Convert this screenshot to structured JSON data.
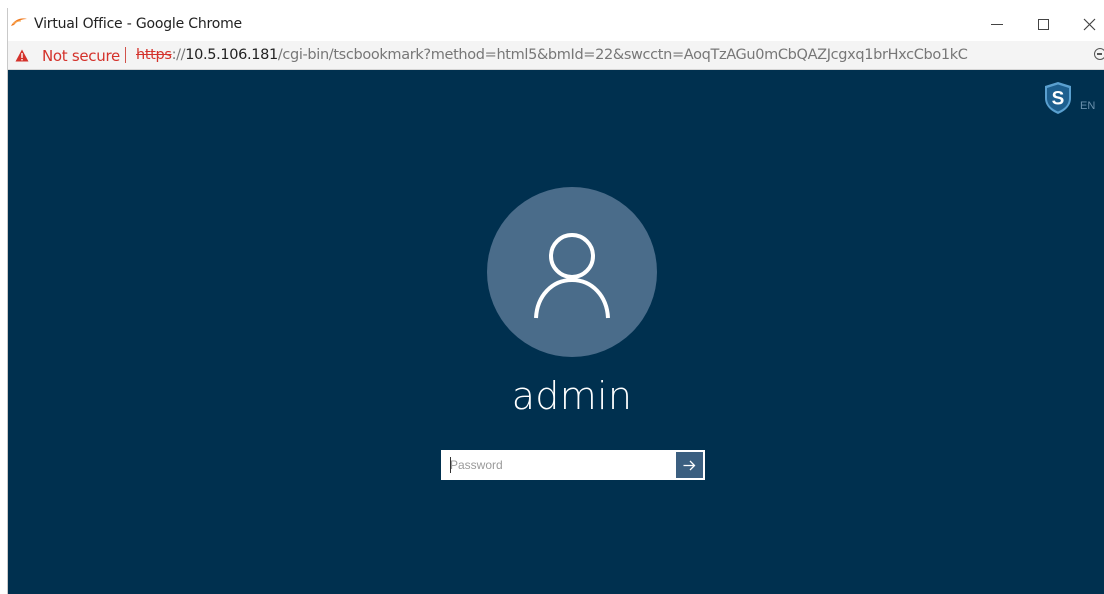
{
  "window": {
    "title": "Virtual Office - Google Chrome"
  },
  "address_bar": {
    "security_label": "Not secure",
    "url_scheme": "https",
    "url_host": "10.5.106.181",
    "url_rest": "/cgi-bin/tscbookmark?method=html5&bmId=22&swcctn=AoqTzAGu0mCbQAZJcgxq1brHxcCbo1kC"
  },
  "header": {
    "brand_badge_letter": "S",
    "language": "EN"
  },
  "login": {
    "username": "admin",
    "password_placeholder": "Password",
    "password_value": ""
  },
  "icons": {
    "app": "chrome-app-icon",
    "warning": "warning-triangle-icon",
    "zoom": "zoom-out-icon",
    "avatar": "user-avatar-icon",
    "submit": "arrow-right-icon"
  },
  "colors": {
    "background": "#00304f",
    "avatar_circle": "#4a6c8a",
    "submit_button": "#3b5f80",
    "badge": "#5aa0d0",
    "security_warning": "#d4322b"
  }
}
